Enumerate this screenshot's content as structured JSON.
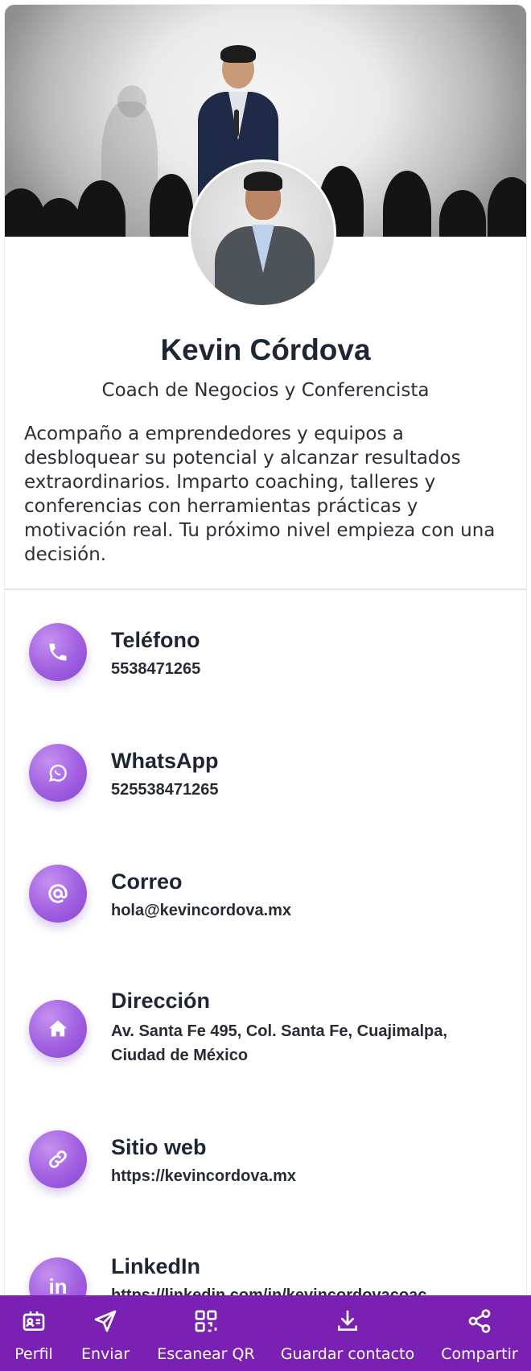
{
  "profile": {
    "name": "Kevin Córdova",
    "role": "Coach de Negocios y Conferencista",
    "bio": "Acompaño a emprendedores y equipos a desbloquear su potencial y alcanzar resultados extraordinarios. Imparto coaching, talleres y conferencias con herramientas prácticas y motivación real. Tu próximo nivel empieza con una decisión."
  },
  "contacts": [
    {
      "icon": "phone-icon",
      "title": "Teléfono",
      "value": "5538471265"
    },
    {
      "icon": "whatsapp-icon",
      "title": "WhatsApp",
      "value": "525538471265"
    },
    {
      "icon": "at-icon",
      "title": "Correo",
      "value": "hola@kevincordova.mx"
    },
    {
      "icon": "home-icon",
      "title": "Dirección",
      "value": "Av. Santa Fe 495, Col. Santa Fe, Cuajimalpa, Ciudad de México"
    },
    {
      "icon": "link-icon",
      "title": "Sitio web",
      "value": "https://kevincordova.mx"
    },
    {
      "icon": "linkedin-icon",
      "title": "LinkedIn",
      "value": "https://linkedin.com/in/kevincordovacoac"
    }
  ],
  "nav": [
    {
      "icon": "profile-card-icon",
      "label": "Perfil"
    },
    {
      "icon": "send-icon",
      "label": "Enviar"
    },
    {
      "icon": "qr-icon",
      "label": "Escanear QR"
    },
    {
      "icon": "download-icon",
      "label": "Guardar contacto"
    },
    {
      "icon": "share-icon",
      "label": "Compartir"
    }
  ],
  "colors": {
    "accent": "#7a21b4",
    "icon_gradient_start": "#c590f0",
    "icon_gradient_end": "#8a45d4",
    "text": "#1f2633"
  }
}
